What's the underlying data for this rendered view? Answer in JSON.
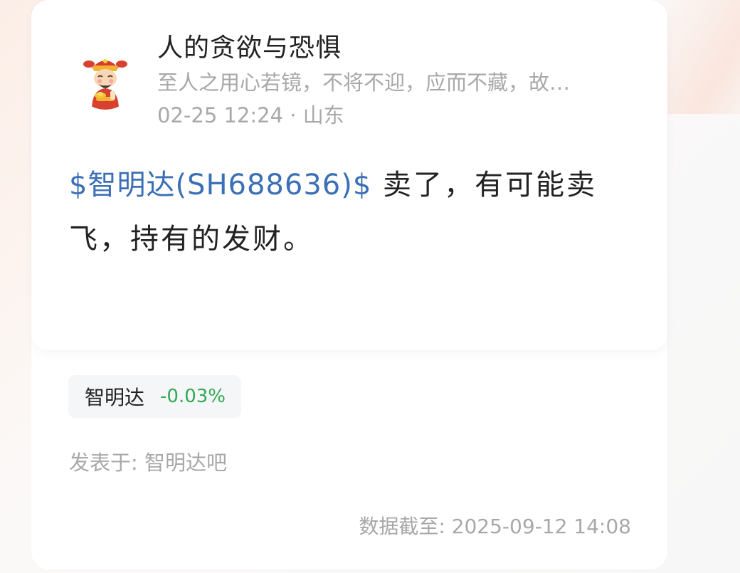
{
  "post": {
    "author_name": "人的贪欲与恐惧",
    "author_signature": "至人之用心若镜，不将不迎，应而不藏，故…",
    "timestamp": "02-25 12:24",
    "separator": " · ",
    "location": "山东",
    "stock_mention": "$智明达(SH688636)$",
    "text": " 卖了，有可能卖飞，持有的发财。"
  },
  "stock_chip": {
    "name": "智明达",
    "change": "-0.03%",
    "change_color": "#33a853"
  },
  "footer": {
    "posted_in": "发表于: 智明达吧",
    "data_as_of": "数据截至: 2025-09-12 14:08"
  },
  "icons": {
    "avatar": "god-of-wealth-avatar-icon"
  },
  "colors": {
    "link": "#3b6fb6",
    "muted_text": "#a8a8a8",
    "primary_text": "#222222"
  }
}
